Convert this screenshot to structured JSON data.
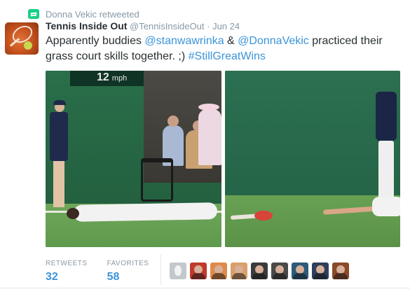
{
  "retweet_context": {
    "text": "Donna Vekic retweeted",
    "icon": "retweet-icon",
    "color": "#19cf86"
  },
  "tweet": {
    "fullname": "Tennis Inside Out",
    "username": "@TennisInsideOut",
    "separator": "·",
    "timestamp": "Jun 24",
    "text_parts": {
      "p1": "Apparently buddies ",
      "mention1": "@stanwawrinka",
      "p2": " & ",
      "mention2": "@DonnaVekic",
      "p3": " practiced their grass court skills together. ;) ",
      "hashtag": "#StillGreatWins"
    },
    "link_color": "#3b94d9"
  },
  "photos": {
    "left": {
      "scoreboard_speed": "12",
      "scoreboard_unit": "mph"
    },
    "right": {}
  },
  "stats": {
    "retweets_label": "RETWEETS",
    "retweets_count": "32",
    "favorites_label": "FAVORITES",
    "favorites_count": "58"
  },
  "favoriters": [
    {
      "icon": "default-egg-avatar",
      "color": "#c2c8cc"
    },
    {
      "icon": "user-avatar",
      "color": "#c0392b"
    },
    {
      "icon": "user-avatar",
      "color": "#e08a4a"
    },
    {
      "icon": "user-avatar",
      "color": "#d9a06a"
    },
    {
      "icon": "user-avatar",
      "color": "#3b3b3b"
    },
    {
      "icon": "user-avatar",
      "color": "#4a4a4a"
    },
    {
      "icon": "user-avatar",
      "color": "#2c5a7a"
    },
    {
      "icon": "user-avatar",
      "color": "#2f3f5a"
    },
    {
      "icon": "user-avatar",
      "color": "#8a4a2a"
    }
  ]
}
